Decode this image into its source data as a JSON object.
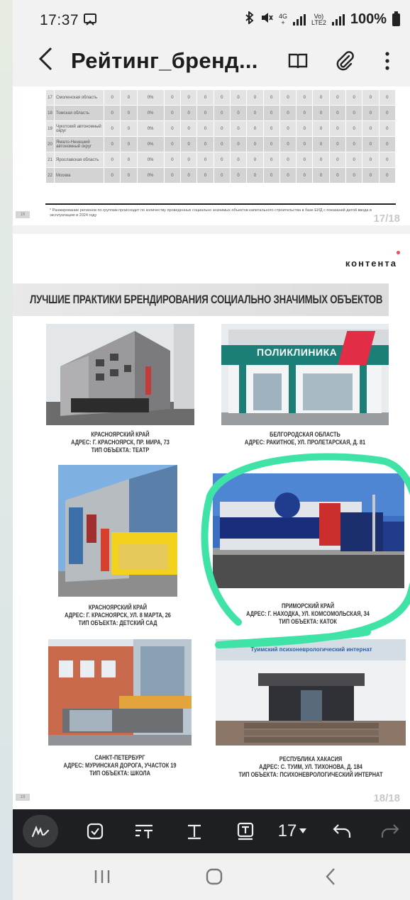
{
  "status": {
    "time": "17:37",
    "network_top": "4G",
    "network_bottom": "+",
    "volte_top": "Vo)",
    "volte_bottom": "LTE2",
    "battery": "100%"
  },
  "appbar": {
    "title": "Рейтинг_бренд..."
  },
  "page17": {
    "rows": [
      {
        "num": "17",
        "region": "Смоленская область",
        "cells": [
          "0",
          "0",
          "0%",
          "0",
          "0",
          "0",
          "0",
          "0",
          "0",
          "0",
          "0",
          "0",
          "0",
          "0",
          "0",
          "0",
          "0"
        ]
      },
      {
        "num": "18",
        "region": "Томская область",
        "cells": [
          "0",
          "0",
          "0%",
          "0",
          "0",
          "0",
          "0",
          "0",
          "0",
          "0",
          "0",
          "0",
          "0",
          "0",
          "0",
          "0",
          "0"
        ]
      },
      {
        "num": "19",
        "region": "Чукотский автономный округ",
        "cells": [
          "0",
          "0",
          "0%",
          "0",
          "0",
          "0",
          "0",
          "0",
          "0",
          "0",
          "0",
          "0",
          "0",
          "0",
          "0",
          "0",
          "0"
        ]
      },
      {
        "num": "20",
        "region": "Ямало-Ненецкий автономный округ",
        "cells": [
          "0",
          "0",
          "0%",
          "0",
          "0",
          "0",
          "0",
          "0",
          "0",
          "0",
          "0",
          "0",
          "0",
          "0",
          "0",
          "0",
          "0"
        ]
      },
      {
        "num": "21",
        "region": "Ярославская область",
        "cells": [
          "0",
          "0",
          "0%",
          "0",
          "0",
          "0",
          "0",
          "0",
          "0",
          "0",
          "0",
          "0",
          "0",
          "0",
          "0",
          "0",
          "0"
        ]
      },
      {
        "num": "22",
        "region": "Москва",
        "cells": [
          "0",
          "0",
          "0%",
          "0",
          "0",
          "0",
          "0",
          "0",
          "0",
          "0",
          "0",
          "0",
          "0",
          "0",
          "0",
          "0",
          "0"
        ]
      }
    ],
    "footnote": "* Ранжирование регионов по группам происходит по количеству проведенных социально значимых объектов капитального строительства в базе ЕИД с показаний датой ввода в эксплуатацию в 2024 году",
    "page_number": "17/18",
    "left_badge": "16"
  },
  "page18": {
    "brand": "контента",
    "heading": "ЛУЧШИЕ ПРАКТИКИ БРЕНДИРОВАНИЯ СОЦИАЛЬНО ЗНАЧИМЫХ ОБЪЕКТОВ",
    "sign_clinic": "ПОЛИКЛИНИКА",
    "captions": [
      [
        "КРАСНОЯРСКИЙ КРАЙ",
        "АДРЕС: Г. КРАСНОЯРСК, ПР. МИРА, 73",
        "ТИП ОБЪЕКТА: ТЕАТР"
      ],
      [
        "БЕЛГОРОДСКАЯ ОБЛАСТЬ",
        "АДРЕС: РАКИТНОЕ, УЛ. ПРОЛЕТАРСКАЯ, Д. 81",
        ""
      ],
      [
        "КРАСНОЯРСКИЙ КРАЙ",
        "АДРЕС: Г. КРАСНОЯРСК, УЛ. 8 МАРТА, 26",
        "ТИП ОБЪЕКТА: ДЕТСКИЙ САД"
      ],
      [
        "ПРИМОРСКИЙ КРАЙ",
        "АДРЕС: Г. НАХОДКА, УЛ. КОМСОМОЛЬСКАЯ, 34",
        "ТИП ОБЪЕКТА: КАТОК"
      ],
      [
        "САНКТ-ПЕТЕРБУРГ",
        "АДРЕС: МУРИНСКАЯ ДОРОГА, УЧАСТОК 19",
        "ТИП ОБЪЕКТА: ШКОЛА"
      ],
      [
        "РЕСПУБЛИКА ХАКАСИЯ",
        "АДРЕС: С. ТУИМ, УЛ. ТИХОНОВА, Д. 184",
        "ТИП ОБЪЕКТА: ПСИХОНЕВРОЛОГИЧЕСКИЙ ИНТЕРНАТ"
      ]
    ],
    "sign_internat": "Туимский психоневрологический интернат",
    "page_number": "18/18",
    "left_badge": "18"
  },
  "toolbar": {
    "font_size": "17"
  },
  "colors": {
    "annotation": "#3fe3a6",
    "clinic_teal": "#1b7f77",
    "toolbar_bg": "#1e1f22"
  }
}
